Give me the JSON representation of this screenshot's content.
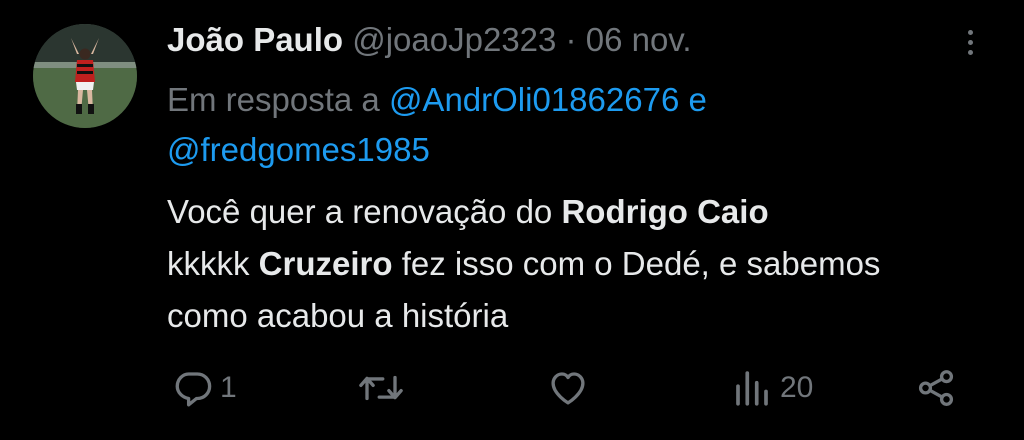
{
  "tweet": {
    "author_name": "João Paulo",
    "handle": "@joaoJp2323",
    "separator": "·",
    "date": "06 nov.",
    "reply_prefix": "Em resposta a",
    "reply_mention_1": "@AndrOli01862676",
    "reply_joiner": "e",
    "reply_mention_2": "@fredgomes1985",
    "text_1": "Você quer a renovação do ",
    "text_bold_1": "Rodrigo Caio",
    "text_2": "kkkkk ",
    "text_bold_2": "Cruzeiro",
    "text_3": " fez isso com o Dedé, e sabemos como acabou a história"
  },
  "actions": {
    "reply_count": "1",
    "retweet_count": "",
    "like_count": "",
    "views_count": "20"
  },
  "icons": [
    "avatar",
    "more-options-icon",
    "reply-icon",
    "retweet-icon",
    "like-icon",
    "views-icon",
    "share-icon"
  ],
  "colors": {
    "background": "#000000",
    "text": "#e7e9ea",
    "muted": "#71767b",
    "mention": "#1d9bf0"
  }
}
